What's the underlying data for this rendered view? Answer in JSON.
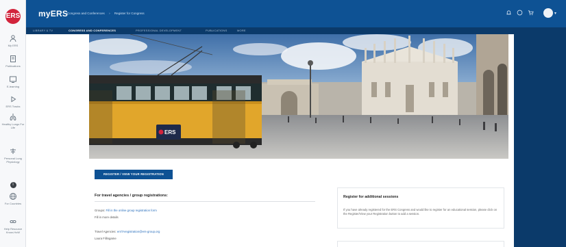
{
  "app": {
    "brand": "myERS",
    "logo_text": "ERS"
  },
  "breadcrumb": [
    "Congress and Conferences",
    "Register for Congress"
  ],
  "header_icons": [
    "bell-icon",
    "help-icon",
    "cart-icon"
  ],
  "nav": {
    "items": [
      {
        "label": "LIBRARY & TV"
      },
      {
        "label": "CONGRESS AND CONFERENCES"
      },
      {
        "label": "PROFESSIONAL DEVELOPMENT"
      },
      {
        "label": "PUBLICATIONS"
      },
      {
        "label": "MORE"
      }
    ]
  },
  "sidebar": {
    "items": [
      {
        "icon": "profile-icon",
        "label": "My ERS"
      },
      {
        "icon": "book-icon",
        "label": "Publications"
      },
      {
        "icon": "learning-icon",
        "label": "E-learning"
      },
      {
        "icon": "play-icon",
        "label": "ERS Tracks"
      },
      {
        "icon": "lungs-icon",
        "label": "Healthy Lungs For Life"
      },
      {
        "icon": "scope-icon",
        "label": "Personal Lung Physiology"
      },
      {
        "icon": "info-icon",
        "label": ""
      },
      {
        "icon": "globe-icon",
        "label": "For Countries"
      },
      {
        "icon": "link-icon",
        "label": "Help Resource Know-HoW"
      }
    ]
  },
  "hero": {
    "tram_badge": "ERS"
  },
  "main": {
    "register_button": "REGISTER / VIEW YOUR REGISTRATION",
    "travel": {
      "heading": "For travel agencies / group registrations:",
      "lines": [
        {
          "label": "Groups:",
          "link": "Fill in the online group registration form"
        },
        {
          "label": "Fill in more details",
          "link": ""
        },
        {
          "label": "Travel Agencies:",
          "link": "ersTAregistration@ers-group.org"
        },
        {
          "label": "Laura Fillingame",
          "link": ""
        }
      ]
    },
    "card": {
      "title": "Register for additional sessions",
      "text": "If you have already registered for the ERS Congress and would like to register for an educational session, please click on the Register/View your Registration button to add a session."
    }
  },
  "colors": {
    "header": "#0e5294",
    "nav": "#0b3a6a",
    "accent": "#d2243c",
    "button": "#0e5294"
  }
}
